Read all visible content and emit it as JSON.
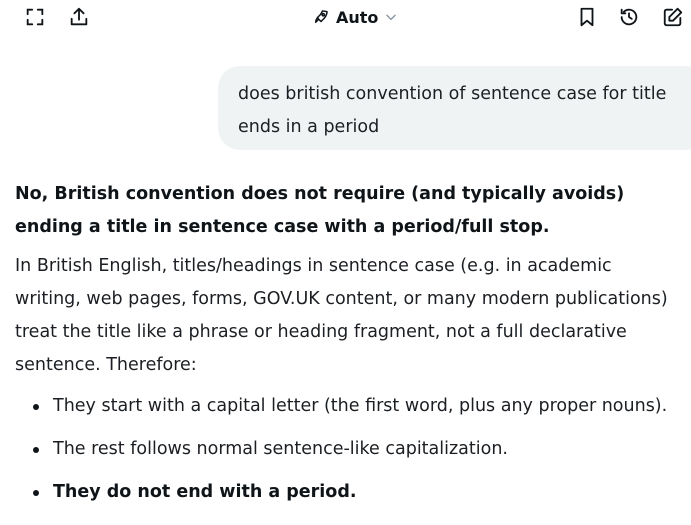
{
  "header": {
    "model_label": "Auto",
    "icons": {
      "left": [
        "expand-icon",
        "share-icon"
      ],
      "model": [
        "rocket-icon",
        "chevron-down-icon"
      ],
      "right": [
        "bookmark-icon",
        "history-icon",
        "new-chat-icon"
      ]
    }
  },
  "conversation": {
    "user_message": "does british convention of sentence case for title ends in a period",
    "response": {
      "lead": "No, British convention does not require (and typically avoids) ending a title in sentence case with a period/full stop.",
      "body": "In British English, titles/headings in sentence case (e.g. in academic writing, web pages, forms, GOV.UK content, or many modern publications) treat the title like a phrase or heading fragment, not a full declarative sentence. Therefore:",
      "bullets": [
        {
          "text": "They start with a capital letter (the first word, plus any proper nouns).",
          "bold": false
        },
        {
          "text": "The rest follows normal sentence-like capitalization.",
          "bold": false
        },
        {
          "text": "They do not end with a period.",
          "bold": true
        }
      ]
    }
  },
  "colors": {
    "text": "#0f1419",
    "bubble_bg": "#eff3f4",
    "icon": "#0f1419",
    "chevron": "#8b98a5"
  }
}
